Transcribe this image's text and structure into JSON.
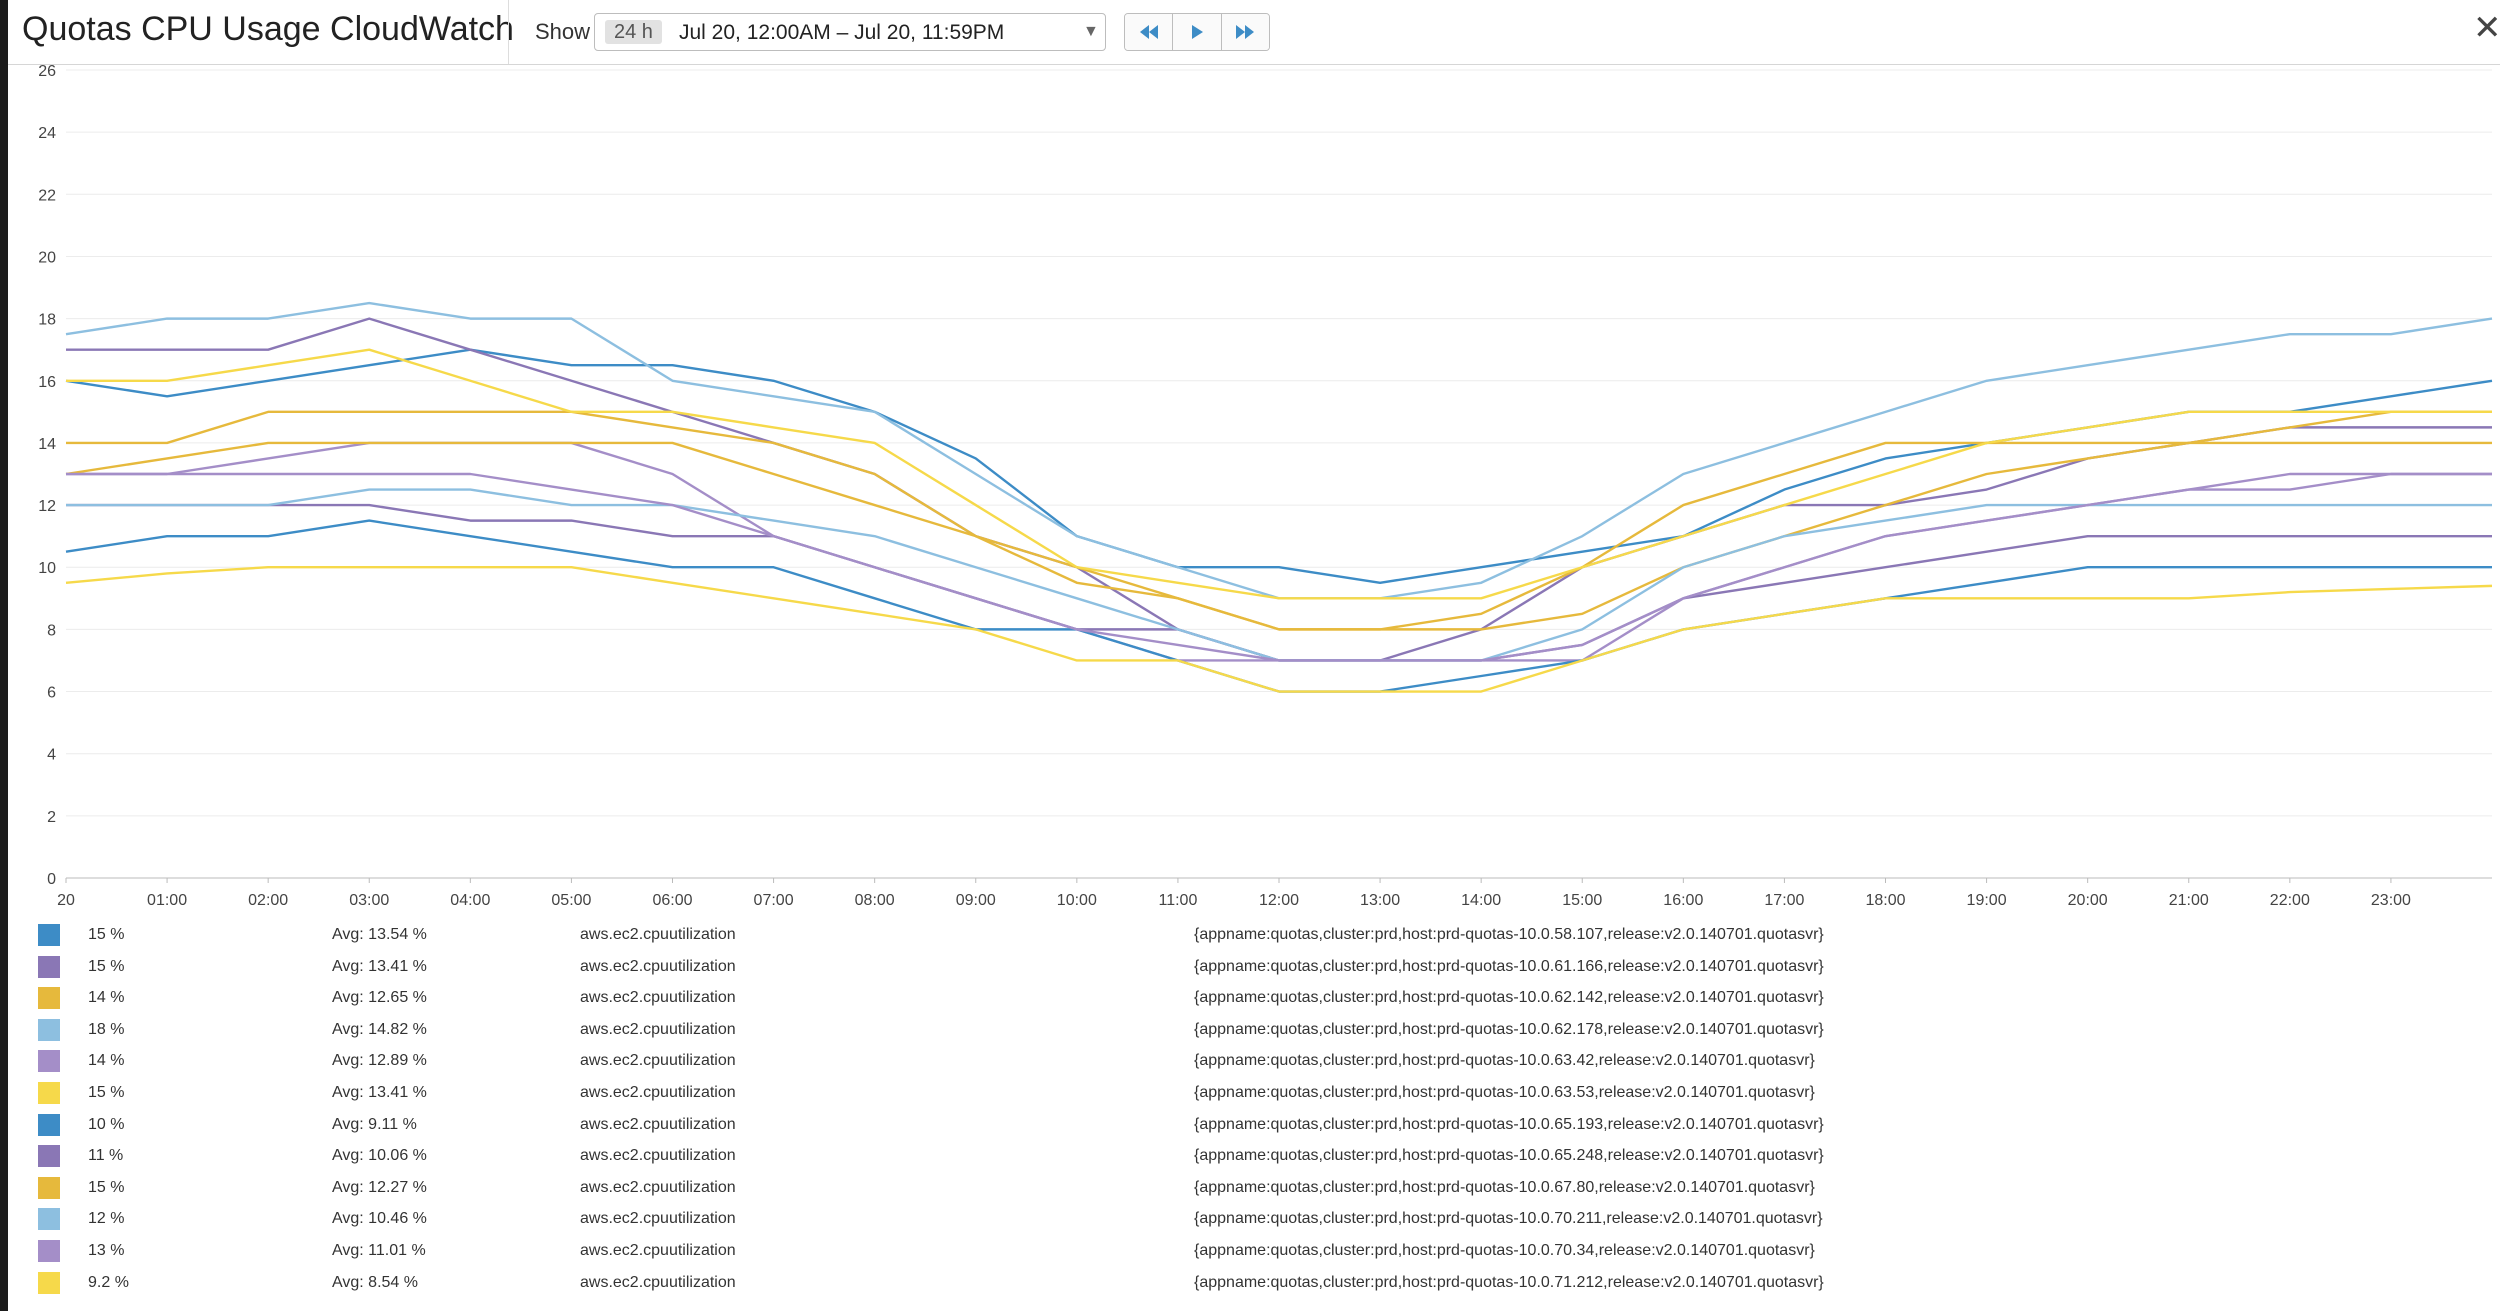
{
  "window": {
    "title": "Quotas CPU Usage CloudWatch",
    "show_label": "Show",
    "range_badge": "24 h",
    "range_text": "Jul 20, 12:00AM – Jul 20, 11:59PM"
  },
  "colors": {
    "blue": "#3d8cc6",
    "purple": "#8a77b5",
    "gold": "#e6b93c",
    "lightblue": "#8dbfe0",
    "lavender": "#a48ec8",
    "yellow": "#f6d94a",
    "grid": "#ececec",
    "axis_text": "#444444"
  },
  "chart_data": {
    "type": "line",
    "y_ticks": [
      "0",
      "2",
      "4",
      "6",
      "8",
      "10",
      "12",
      "14",
      "16",
      "18",
      "20",
      "22",
      "24",
      "26"
    ],
    "ylim": [
      0,
      26
    ],
    "x_ticks": [
      "20",
      "01:00",
      "02:00",
      "03:00",
      "04:00",
      "05:00",
      "06:00",
      "07:00",
      "08:00",
      "09:00",
      "10:00",
      "11:00",
      "12:00",
      "13:00",
      "14:00",
      "15:00",
      "16:00",
      "17:00",
      "18:00",
      "19:00",
      "20:00",
      "21:00",
      "22:00",
      "23:00"
    ],
    "xlim": [
      0,
      24
    ],
    "grid": true,
    "legend_position": "bottom",
    "x_hours": [
      0,
      1,
      2,
      3,
      4,
      5,
      6,
      7,
      8,
      9,
      10,
      11,
      12,
      13,
      14,
      15,
      16,
      17,
      18,
      19,
      20,
      21,
      22,
      23,
      24
    ],
    "series": [
      {
        "color": "blue",
        "values": [
          16,
          15.5,
          16,
          16.5,
          17,
          16.5,
          16.5,
          16,
          15,
          13.5,
          11,
          10,
          10,
          9.5,
          10,
          10.5,
          11,
          12.5,
          13.5,
          14,
          14.5,
          15,
          15,
          15.5,
          16
        ]
      },
      {
        "color": "purple",
        "values": [
          17,
          17,
          17,
          18,
          17,
          16,
          15,
          14,
          13,
          11,
          10,
          8,
          7,
          7,
          8,
          10,
          11,
          12,
          12,
          12.5,
          13.5,
          14,
          14.5,
          14.5,
          14.5
        ]
      },
      {
        "color": "gold",
        "values": [
          14,
          14,
          15,
          15,
          15,
          15,
          14.5,
          14,
          13,
          11,
          10,
          9,
          8,
          8,
          8.5,
          10,
          12,
          13,
          14,
          14,
          14,
          14,
          14.5,
          15,
          15
        ]
      },
      {
        "color": "lightblue",
        "values": [
          17.5,
          18,
          18,
          18.5,
          18,
          18,
          16,
          15.5,
          15,
          13,
          11,
          10,
          9,
          9,
          9.5,
          11,
          13,
          14,
          15,
          16,
          16.5,
          17,
          17.5,
          17.5,
          18
        ]
      },
      {
        "color": "lavender",
        "values": [
          13,
          13,
          13.5,
          14,
          14,
          14,
          13,
          11,
          10,
          9,
          8,
          7,
          7,
          7,
          7,
          7,
          9,
          10,
          11,
          11.5,
          12,
          12.5,
          13,
          13,
          13
        ]
      },
      {
        "color": "yellow",
        "values": [
          16,
          16,
          16.5,
          17,
          16,
          15,
          15,
          14.5,
          14,
          12,
          10,
          9.5,
          9,
          9,
          9,
          10,
          11,
          12,
          13,
          14,
          14.5,
          15,
          15,
          15,
          15
        ]
      },
      {
        "color": "blue",
        "values": [
          10.5,
          11,
          11,
          11.5,
          11,
          10.5,
          10,
          10,
          9,
          8,
          8,
          7,
          6,
          6,
          6.5,
          7,
          8,
          8.5,
          9,
          9.5,
          10,
          10,
          10,
          10,
          10
        ]
      },
      {
        "color": "purple",
        "values": [
          12,
          12,
          12,
          12,
          11.5,
          11.5,
          11,
          11,
          10,
          9,
          8,
          8,
          7,
          7,
          7,
          7.5,
          9,
          9.5,
          10,
          10.5,
          11,
          11,
          11,
          11,
          11
        ]
      },
      {
        "color": "gold",
        "values": [
          13,
          13.5,
          14,
          14,
          14,
          14,
          14,
          13,
          12,
          11,
          9.5,
          9,
          8,
          8,
          8,
          8.5,
          10,
          11,
          12,
          13,
          13.5,
          14,
          14,
          14,
          14
        ]
      },
      {
        "color": "lightblue",
        "values": [
          12,
          12,
          12,
          12.5,
          12.5,
          12,
          12,
          11.5,
          11,
          10,
          9,
          8,
          7,
          7,
          7,
          8,
          10,
          11,
          11.5,
          12,
          12,
          12,
          12,
          12,
          12
        ]
      },
      {
        "color": "lavender",
        "values": [
          13,
          13,
          13,
          13,
          13,
          12.5,
          12,
          11,
          10,
          9,
          8,
          7.5,
          7,
          7,
          7,
          7.5,
          9,
          10,
          11,
          11.5,
          12,
          12.5,
          12.5,
          13,
          13
        ]
      },
      {
        "color": "yellow",
        "values": [
          9.5,
          9.8,
          10,
          10,
          10,
          10,
          9.5,
          9,
          8.5,
          8,
          7,
          7,
          6,
          6,
          6,
          7,
          8,
          8.5,
          9,
          9,
          9,
          9,
          9.2,
          9.3,
          9.4
        ]
      }
    ]
  },
  "legend": [
    {
      "color": "blue",
      "current": "15 %",
      "avg": "Avg: 13.54 %",
      "metric": "aws.ec2.cpuutilization",
      "tags": "{appname:quotas,cluster:prd,host:prd-quotas-10.0.58.107,release:v2.0.140701.quotasvr}"
    },
    {
      "color": "purple",
      "current": "15 %",
      "avg": "Avg: 13.41 %",
      "metric": "aws.ec2.cpuutilization",
      "tags": "{appname:quotas,cluster:prd,host:prd-quotas-10.0.61.166,release:v2.0.140701.quotasvr}"
    },
    {
      "color": "gold",
      "current": "14 %",
      "avg": "Avg: 12.65 %",
      "metric": "aws.ec2.cpuutilization",
      "tags": "{appname:quotas,cluster:prd,host:prd-quotas-10.0.62.142,release:v2.0.140701.quotasvr}"
    },
    {
      "color": "lightblue",
      "current": "18 %",
      "avg": "Avg: 14.82 %",
      "metric": "aws.ec2.cpuutilization",
      "tags": "{appname:quotas,cluster:prd,host:prd-quotas-10.0.62.178,release:v2.0.140701.quotasvr}"
    },
    {
      "color": "lavender",
      "current": "14 %",
      "avg": "Avg: 12.89 %",
      "metric": "aws.ec2.cpuutilization",
      "tags": "{appname:quotas,cluster:prd,host:prd-quotas-10.0.63.42,release:v2.0.140701.quotasvr}"
    },
    {
      "color": "yellow",
      "current": "15 %",
      "avg": "Avg: 13.41 %",
      "metric": "aws.ec2.cpuutilization",
      "tags": "{appname:quotas,cluster:prd,host:prd-quotas-10.0.63.53,release:v2.0.140701.quotasvr}"
    },
    {
      "color": "blue",
      "current": "10 %",
      "avg": "Avg: 9.11 %",
      "metric": "aws.ec2.cpuutilization",
      "tags": "{appname:quotas,cluster:prd,host:prd-quotas-10.0.65.193,release:v2.0.140701.quotasvr}"
    },
    {
      "color": "purple",
      "current": "11 %",
      "avg": "Avg: 10.06 %",
      "metric": "aws.ec2.cpuutilization",
      "tags": "{appname:quotas,cluster:prd,host:prd-quotas-10.0.65.248,release:v2.0.140701.quotasvr}"
    },
    {
      "color": "gold",
      "current": "15 %",
      "avg": "Avg: 12.27 %",
      "metric": "aws.ec2.cpuutilization",
      "tags": "{appname:quotas,cluster:prd,host:prd-quotas-10.0.67.80,release:v2.0.140701.quotasvr}"
    },
    {
      "color": "lightblue",
      "current": "12 %",
      "avg": "Avg: 10.46 %",
      "metric": "aws.ec2.cpuutilization",
      "tags": "{appname:quotas,cluster:prd,host:prd-quotas-10.0.70.211,release:v2.0.140701.quotasvr}"
    },
    {
      "color": "lavender",
      "current": "13 %",
      "avg": "Avg: 11.01 %",
      "metric": "aws.ec2.cpuutilization",
      "tags": "{appname:quotas,cluster:prd,host:prd-quotas-10.0.70.34,release:v2.0.140701.quotasvr}"
    },
    {
      "color": "yellow",
      "current": "9.2 %",
      "avg": "Avg: 8.54 %",
      "metric": "aws.ec2.cpuutilization",
      "tags": "{appname:quotas,cluster:prd,host:prd-quotas-10.0.71.212,release:v2.0.140701.quotasvr}"
    }
  ]
}
